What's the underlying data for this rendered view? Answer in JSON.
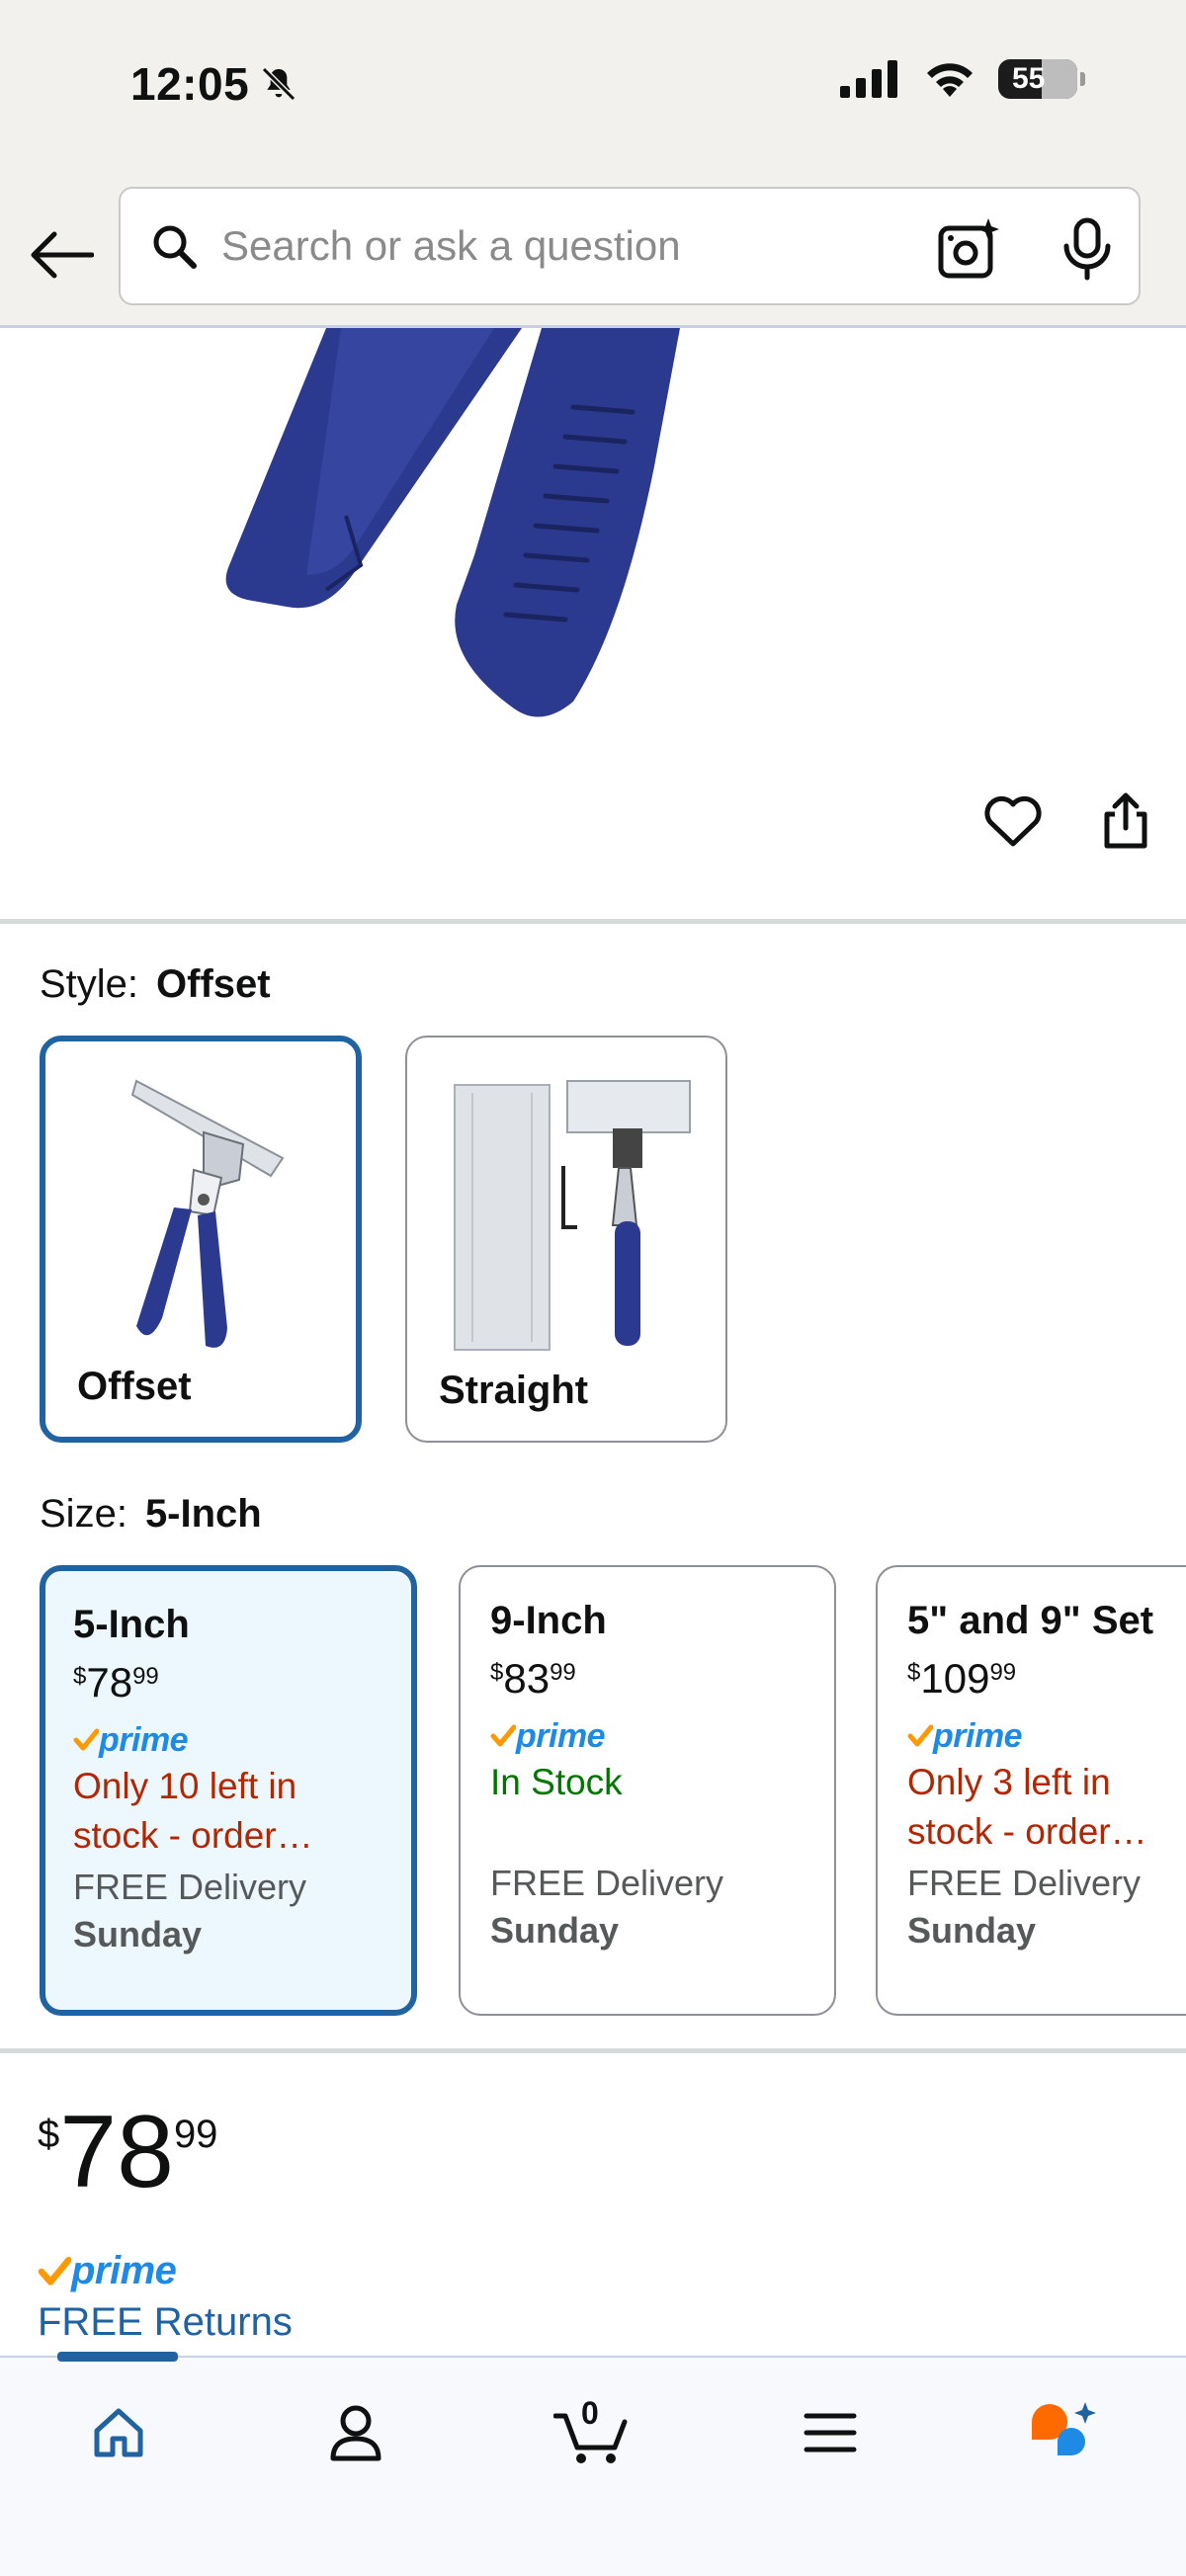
{
  "status_bar": {
    "time": "12:05",
    "battery": "55"
  },
  "search": {
    "placeholder": "Search or ask a question"
  },
  "style": {
    "label": "Style:",
    "selected_value": "Offset",
    "options": [
      {
        "label": "Offset",
        "selected": true
      },
      {
        "label": "Straight",
        "selected": false
      }
    ]
  },
  "size": {
    "label": "Size:",
    "selected_value": "5-Inch",
    "options": [
      {
        "name": "5-Inch",
        "price_symbol": "$",
        "price_whole": "78",
        "price_fraction": "99",
        "prime": "prime",
        "stock": "Only 10 left in stock - order…",
        "stock_status": "low",
        "delivery": "FREE Delivery",
        "delivery_day": "Sunday",
        "selected": true
      },
      {
        "name": "9-Inch",
        "price_symbol": "$",
        "price_whole": "83",
        "price_fraction": "99",
        "prime": "prime",
        "stock": "In Stock",
        "stock_status": "ok",
        "delivery": "FREE Delivery",
        "delivery_day": "Sunday",
        "selected": false
      },
      {
        "name": "5\" and 9\" Set",
        "price_symbol": "$",
        "price_whole": "109",
        "price_fraction": "99",
        "prime": "prime",
        "stock": "Only 3 left in stock - order…",
        "stock_status": "low",
        "delivery": "FREE Delivery",
        "delivery_day": "Sunday",
        "selected": false
      }
    ]
  },
  "main_price": {
    "symbol": "$",
    "whole": "78",
    "fraction": "99",
    "prime": "prime",
    "returns": "FREE Returns"
  },
  "bottom_nav": {
    "cart_count": "0",
    "items": [
      "home-icon",
      "account-icon",
      "cart-icon",
      "menu-icon",
      "assistant-icon"
    ]
  },
  "colors": {
    "accent": "#2162a1",
    "prime_blue": "#1f8ae3",
    "prime_check": "#ff9900",
    "low_stock": "#b12704",
    "in_stock": "#007600"
  }
}
